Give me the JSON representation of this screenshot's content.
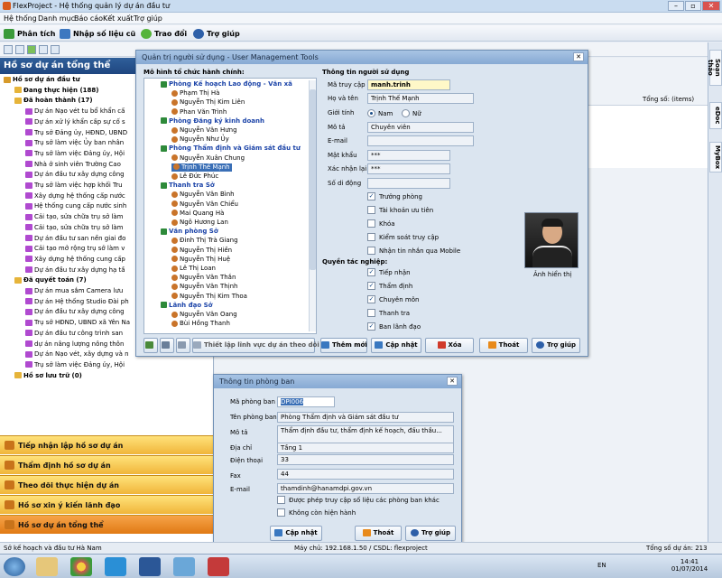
{
  "window": {
    "title": "FlexProject - Hệ thống quản lý dự án đầu tư"
  },
  "menu": [
    "Hệ thống",
    "Danh mục",
    "Báo cáo",
    "Kết xuất",
    "Trợ giúp"
  ],
  "toolbar": {
    "analysis": "Phân tích",
    "import": "Nhập số liệu cũ",
    "chat": "Trao đổi",
    "help": "Trợ giúp"
  },
  "left": {
    "title": "Hồ sơ dự án tổng thể",
    "tree": [
      {
        "t": "Hồ sơ dự án đầu tư",
        "l": 0,
        "b": true
      },
      {
        "t": "Đang thực hiện (188)",
        "l": 1,
        "b": true
      },
      {
        "t": "Đã hoàn thành (17)",
        "l": 1,
        "b": true
      },
      {
        "t": "Dự án Nạo vét tu bổ khẩn cấ",
        "l": 2
      },
      {
        "t": "Dự án xử lý khẩn cấp sự cố s",
        "l": 2
      },
      {
        "t": "Trụ sở Đảng ủy, HĐND, UBND",
        "l": 2
      },
      {
        "t": "Trụ sở làm việc Ủy ban nhân",
        "l": 2
      },
      {
        "t": "Trụ sở làm việc Đảng ủy, Hội",
        "l": 2
      },
      {
        "t": "Nhà ở sinh viên Trường Cao",
        "l": 2
      },
      {
        "t": "Dự án đầu tư xây dựng công",
        "l": 2
      },
      {
        "t": "Trụ sở làm việc hợp khối Tru",
        "l": 2
      },
      {
        "t": "Xây dựng hệ thống cấp nước",
        "l": 2
      },
      {
        "t": "Hệ thống cung cấp nước sinh",
        "l": 2
      },
      {
        "t": "Cải tạo, sửa chữa trụ sở làm",
        "l": 2
      },
      {
        "t": "Cải tạo, sửa chữa trụ sở làm",
        "l": 2
      },
      {
        "t": "Dự án đầu tư san nền giai đo",
        "l": 2
      },
      {
        "t": "Cải tạo mở rộng trụ sở làm v",
        "l": 2
      },
      {
        "t": "Xây dựng hệ thống cung cấp",
        "l": 2
      },
      {
        "t": "Dự án đầu tư xây dựng hạ tầ",
        "l": 2
      },
      {
        "t": "Đã quyết toán (7)",
        "l": 1,
        "b": true
      },
      {
        "t": "Dự án mua sắm Camera lưu",
        "l": 2
      },
      {
        "t": "Dự án Hệ thống Studio Đài ph",
        "l": 2
      },
      {
        "t": "Dự án đầu tư xây dựng công",
        "l": 2
      },
      {
        "t": "Trụ sở HĐND, UBND xã Yên Na",
        "l": 2
      },
      {
        "t": "Dự án đầu tư công trình san",
        "l": 2
      },
      {
        "t": "dự án nâng lượng nông thôn",
        "l": 2
      },
      {
        "t": "Dự án Nạo vét, xây dựng và n",
        "l": 2
      },
      {
        "t": "Trụ sở làm việc Đảng ủy, Hội",
        "l": 2
      },
      {
        "t": "Hồ sơ lưu trữ (0)",
        "l": 1,
        "b": true
      }
    ],
    "nav": [
      "Tiếp nhận lập hồ sơ dự án",
      "Thẩm định hồ sơ dự án",
      "Theo dõi thực hiện dự án",
      "Hồ sơ xin ý kiến lãnh đạo",
      "Hồ sơ dự án tổng thể"
    ]
  },
  "rightpane": {
    "total": "Tổng số: (items)"
  },
  "sidetabs": [
    "Soạn thảo",
    "eDoc",
    "MyBox"
  ],
  "user_dialog": {
    "title": "Quản trị người sử dụng - User Management Tools",
    "org_label": "Mô hình tổ chức hành chính:",
    "org": [
      {
        "t": "Phòng Kế hoạch Lao động - Văn xã",
        "d": true
      },
      {
        "t": "Phạm Thị Hà"
      },
      {
        "t": "Nguyễn Thị Kim Liên"
      },
      {
        "t": "Phan Văn Trình"
      },
      {
        "t": "Phòng Đăng ký kinh doanh",
        "d": true
      },
      {
        "t": "Nguyễn Văn Hưng"
      },
      {
        "t": "Nguyễn Như Ủy"
      },
      {
        "t": "Phòng Thẩm định và Giám sát đầu tư",
        "d": true
      },
      {
        "t": "Nguyễn Xuân Chung"
      },
      {
        "t": "Trịnh Thế Mạnh",
        "s": true
      },
      {
        "t": "Lê Đức Phúc"
      },
      {
        "t": "Thanh tra Sở",
        "d": true
      },
      {
        "t": "Nguyễn Văn Bình"
      },
      {
        "t": "Nguyễn Văn Chiểu"
      },
      {
        "t": "Mai Quang Hà"
      },
      {
        "t": "Ngô Hương Lan"
      },
      {
        "t": "Văn phòng Sở",
        "d": true
      },
      {
        "t": "Đinh Thị Trà Giang"
      },
      {
        "t": "Nguyễn Thị Hiền"
      },
      {
        "t": "Nguyễn Thị Huệ"
      },
      {
        "t": "Lê Thị Loan"
      },
      {
        "t": "Nguyễn Văn Thắn"
      },
      {
        "t": "Nguyễn Văn Thịnh"
      },
      {
        "t": "Nguyễn Thị Kim Thoa"
      },
      {
        "t": "Lãnh đạo Sở",
        "d": true
      },
      {
        "t": "Nguyễn Văn Oang"
      },
      {
        "t": "Bùi Hồng Thanh"
      }
    ],
    "info_label": "Thông tin người sử dụng",
    "f_login": "Mã truy cập",
    "v_login": "manh.trinh",
    "f_name": "Họ và tên",
    "v_name": "Trịnh Thế Mạnh",
    "f_gender": "Giới tính",
    "g_male": "Nam",
    "g_female": "Nữ",
    "f_desc": "Mô tả",
    "v_desc": "Chuyên viên",
    "f_email": "E-mail",
    "v_email": "",
    "f_pass": "Mật khẩu",
    "v_pass": "***",
    "f_repass": "Xác nhận lại",
    "v_repass": "***",
    "f_phone": "Số di động",
    "v_phone": "",
    "checks": [
      "Trưởng phòng",
      "Tài khoản ưu tiên",
      "Khóa",
      "Kiểm soát truy cập",
      "Nhận tin nhắn qua Mobile"
    ],
    "checks_on": [
      true,
      false,
      false,
      false,
      false
    ],
    "photo_caption": "Ảnh hiển thị",
    "perm_label": "Quyền tác nghiệp:",
    "perms": [
      "Tiếp nhận",
      "Thẩm định",
      "Chuyên môn",
      "Thanh tra",
      "Ban lãnh đạo"
    ],
    "perms_on": [
      true,
      true,
      true,
      false,
      true
    ],
    "btn_field": "Thiết lập lĩnh vực dự án theo dõi",
    "btn_new": "Thêm mới",
    "btn_update": "Cập nhật",
    "btn_delete": "Xóa",
    "btn_exit": "Thoát",
    "btn_help": "Trợ giúp"
  },
  "dept_dialog": {
    "title": "Thông tin phòng ban",
    "f_code": "Mã phòng ban",
    "v_code": "DPI006",
    "f_name": "Tên phòng ban",
    "v_name": "Phòng Thẩm định và Giám sát đầu tư",
    "f_desc": "Mô tả",
    "v_desc": "Thẩm định đầu tư, thẩm định kế hoạch, đấu thầu...",
    "f_addr": "Địa chỉ",
    "v_addr": "Tầng 1",
    "f_phone": "Điện thoại",
    "v_phone": "33",
    "f_fax": "Fax",
    "v_fax": "44",
    "f_email": "E-mail",
    "v_email": "thamdinh@hanamdpi.gov.vn",
    "chk1": "Được phép truy cập số liệu các phòng ban khác",
    "chk2": "Không còn hiện hành",
    "btn_update": "Cập nhật",
    "btn_exit": "Thoát",
    "btn_help": "Trợ giúp"
  },
  "status": {
    "left": "Sở kế hoạch và đầu tư Hà Nam",
    "mid": "Máy chủ: 192.168.1.50 / CSDL: flexproject",
    "right": "Tổng số dự án: 213"
  },
  "taskbar": {
    "lang": "EN",
    "time": "14:41",
    "date": "01/07/2014"
  }
}
